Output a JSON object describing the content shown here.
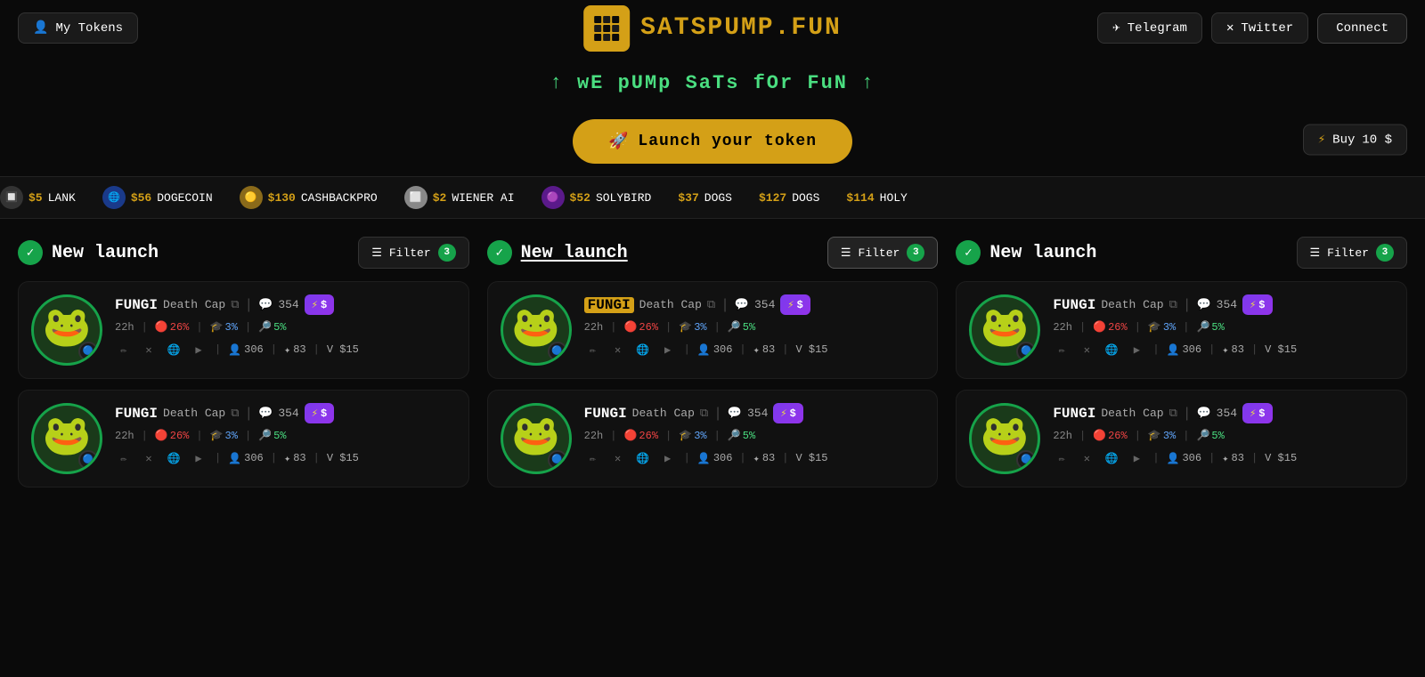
{
  "header": {
    "my_tokens_label": "My Tokens",
    "logo_name": "SATSPUMP",
    "logo_suffix": ".FUN",
    "telegram_label": "Telegram",
    "twitter_label": "Twitter",
    "connect_label": "Connect"
  },
  "tagline": {
    "text": "↑ wE pUMp SaTs fOr FuN ↑"
  },
  "launch": {
    "button_label": "Launch your token"
  },
  "buy_widget": {
    "label": "Buy",
    "value": "10 $"
  },
  "ticker": {
    "items": [
      {
        "icon": "🔲",
        "price": "$5",
        "name": "LANK"
      },
      {
        "icon": "🌐",
        "price": "$56",
        "name": "DOGECOIN"
      },
      {
        "icon": "🟡",
        "price": "$130",
        "name": "CASHBACKPRO"
      },
      {
        "icon": "⬜",
        "price": "$2",
        "name": "WIENER AI"
      },
      {
        "icon": "🟣",
        "price": "$52",
        "name": "SOLYBIRD"
      },
      {
        "icon": "",
        "price": "$37",
        "name": "DOGS"
      },
      {
        "icon": "",
        "price": "$127",
        "name": "DOGS"
      },
      {
        "icon": "",
        "price": "$114",
        "name": "HOLY"
      }
    ]
  },
  "columns": [
    {
      "id": "col1",
      "title": "New launch",
      "filter_label": "Filter",
      "filter_count": "3",
      "active": false,
      "cards": [
        {
          "name": "FUNGI",
          "name_highlighted": false,
          "desc": "Death Cap",
          "comments": "354",
          "time": "22h",
          "stat1": "26%",
          "stat2": "3%",
          "stat3": "5%",
          "holders": "306",
          "stars": "83",
          "vol": "$15"
        },
        {
          "name": "FUNGI",
          "name_highlighted": false,
          "desc": "Death Cap",
          "comments": "354",
          "time": "22h",
          "stat1": "26%",
          "stat2": "3%",
          "stat3": "5%",
          "holders": "306",
          "stars": "83",
          "vol": "$15"
        }
      ]
    },
    {
      "id": "col2",
      "title": "New launch",
      "filter_label": "Filter",
      "filter_count": "3",
      "active": true,
      "cards": [
        {
          "name": "FUNGI",
          "name_highlighted": true,
          "desc": "Death Cap",
          "comments": "354",
          "time": "22h",
          "stat1": "26%",
          "stat2": "3%",
          "stat3": "5%",
          "holders": "306",
          "stars": "83",
          "vol": "$15"
        },
        {
          "name": "FUNGI",
          "name_highlighted": false,
          "desc": "Death Cap",
          "comments": "354",
          "time": "22h",
          "stat1": "26%",
          "stat2": "3%",
          "stat3": "5%",
          "holders": "306",
          "stars": "83",
          "vol": "$15"
        }
      ]
    },
    {
      "id": "col3",
      "title": "New launch",
      "filter_label": "Filter",
      "filter_count": "3",
      "active": false,
      "cards": [
        {
          "name": "FUNGI",
          "name_highlighted": false,
          "desc": "Death Cap",
          "comments": "354",
          "time": "22h",
          "stat1": "26%",
          "stat2": "3%",
          "stat3": "5%",
          "holders": "306",
          "stars": "83",
          "vol": "$15"
        },
        {
          "name": "FUNGI",
          "name_highlighted": false,
          "desc": "Death Cap",
          "comments": "354",
          "time": "22h",
          "stat1": "26%",
          "stat2": "3%",
          "stat3": "5%",
          "holders": "306",
          "stars": "83",
          "vol": "$15"
        }
      ]
    }
  ]
}
